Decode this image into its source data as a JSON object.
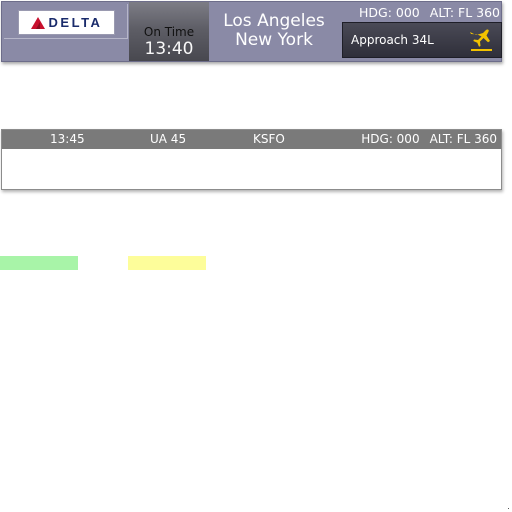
{
  "strip": {
    "airline_logo_text": "DELTA",
    "status_label": "On Time",
    "status_time": "13:40",
    "route_from": "Los Angeles",
    "route_to": "New York",
    "hdg": "HDG: 000",
    "alt": "ALT: FL 360",
    "approach": "Approach 34L",
    "plane_icon": "airplane-landing-icon",
    "accent_color": "#f2c200"
  },
  "strip2": {
    "time": "13:45",
    "flight": "UA 45",
    "destination": "KSFO",
    "hdg": "HDG: 000",
    "alt": "ALT: FL 360"
  },
  "colors": {
    "green_bar": "#a8f4a8",
    "yellow_bar": "#fdfd9a"
  }
}
